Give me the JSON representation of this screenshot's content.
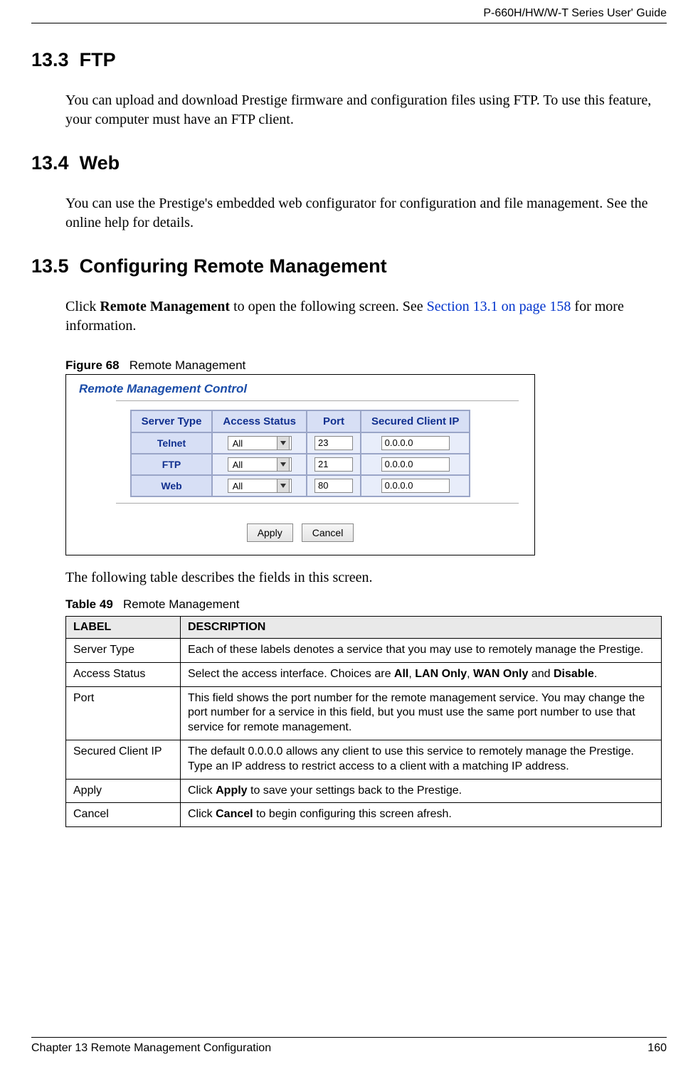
{
  "header": {
    "guide_title": "P-660H/HW/W-T Series User' Guide"
  },
  "sections": {
    "s3": {
      "num": "13.3",
      "title": "FTP",
      "para": "You can upload and download Prestige firmware and configuration files using FTP. To use this feature, your computer must have an FTP client."
    },
    "s4": {
      "num": "13.4",
      "title": "Web",
      "para": "You can use the Prestige's embedded web configurator for configuration and file management. See the online help for details."
    },
    "s5": {
      "num": "13.5",
      "title": "Configuring Remote Management",
      "para_prefix": "Click ",
      "para_bold": "Remote Management",
      "para_mid": " to open the following screen. See ",
      "para_link": "Section 13.1 on page 158",
      "para_suffix": " for more information."
    }
  },
  "figure": {
    "label": "Figure 68",
    "caption": "Remote Management",
    "panel_title": "Remote Management Control",
    "columns": {
      "c1": "Server Type",
      "c2": "Access Status",
      "c3": "Port",
      "c4": "Secured Client IP"
    },
    "rows": [
      {
        "type": "Telnet",
        "access": "All",
        "port": "23",
        "ip": "0.0.0.0"
      },
      {
        "type": "FTP",
        "access": "All",
        "port": "21",
        "ip": "0.0.0.0"
      },
      {
        "type": "Web",
        "access": "All",
        "port": "80",
        "ip": "0.0.0.0"
      }
    ],
    "buttons": {
      "apply": "Apply",
      "cancel": "Cancel"
    }
  },
  "post_fig_para": "The following table describes the fields in this screen.",
  "table49": {
    "label": "Table 49",
    "caption": "Remote Management",
    "head": {
      "c1": "LABEL",
      "c2": "DESCRIPTION"
    },
    "rows": {
      "0": {
        "label": "Server Type",
        "desc": "Each of these labels denotes a service that you may use to remotely manage the Prestige."
      },
      "1": {
        "label": "Access Status",
        "d_pre": "Select the access interface. Choices are ",
        "d_b1": "All",
        "d_s1": ", ",
        "d_b2": "LAN Only",
        "d_s2": ", ",
        "d_b3": "WAN Only",
        "d_s3": " and ",
        "d_b4": "Disable",
        "d_suf": "."
      },
      "2": {
        "label": "Port",
        "desc": "This field shows the port number for the remote management service. You may change the port number for a service in this field, but you must use the same port number to use that service for remote management."
      },
      "3": {
        "label": "Secured Client IP",
        "desc": "The default 0.0.0.0 allows any client to use this service to remotely manage the Prestige. Type an IP address to restrict access to a client with a matching IP address."
      },
      "4": {
        "label": "Apply",
        "d_pre": "Click ",
        "d_b1": "Apply",
        "d_suf": " to save your settings back to the Prestige."
      },
      "5": {
        "label": "Cancel",
        "d_pre": "Click ",
        "d_b1": "Cancel",
        "d_suf": " to begin configuring this screen afresh."
      }
    }
  },
  "footer": {
    "chapter": "Chapter 13 Remote Management Configuration",
    "page": "160"
  }
}
